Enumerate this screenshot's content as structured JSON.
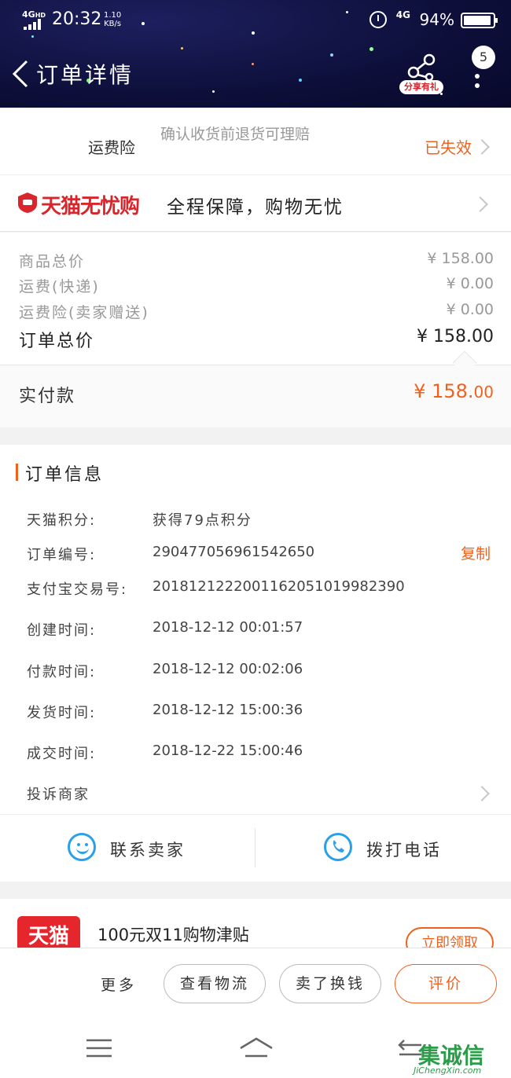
{
  "status_bar": {
    "network_left": "4G",
    "network_hd": "HD",
    "time": "20:32",
    "speed_value": "1.10",
    "speed_unit": "KB/s",
    "network_right": "4G",
    "battery": "94%"
  },
  "header": {
    "title": "订单详情",
    "share_label": "分享有礼",
    "message_count": "5"
  },
  "insurance": {
    "label": "运费险",
    "description": "确认收货前退货可理赔",
    "status": "已失效"
  },
  "guarantee": {
    "brand": "天猫无忧购",
    "slogan": "全程保障，购物无忧"
  },
  "price": {
    "items": [
      {
        "label": "商品总价",
        "value": "¥ 158.00"
      },
      {
        "label": "运费(快递)",
        "value": "¥ 0.00"
      },
      {
        "label": "运费险(卖家赠送)",
        "value": "¥ 0.00"
      }
    ],
    "total_label": "订单总价",
    "total_value": "¥ 158.00",
    "paid_label": "实付款",
    "paid_currency_int": "¥ 158.",
    "paid_decimal": "00"
  },
  "order_info": {
    "title": "订单信息",
    "rows": [
      {
        "label": "天猫积分:",
        "value": "获得79点积分"
      },
      {
        "label": "订单编号:",
        "value": "290477056961542650"
      },
      {
        "label": "支付宝交易号:",
        "value": "2018121222001162051019982390"
      },
      {
        "label": "创建时间:",
        "value": "2018-12-12 00:01:57"
      },
      {
        "label": "付款时间:",
        "value": "2018-12-12 00:02:06"
      },
      {
        "label": "发货时间:",
        "value": "2018-12-12 15:00:36"
      },
      {
        "label": "成交时间:",
        "value": "2018-12-22 15:00:46"
      }
    ],
    "copy_label": "复制",
    "complain_label": "投诉商家"
  },
  "contact": {
    "seller": "联系卖家",
    "phone": "拨打电话"
  },
  "promo": {
    "logo_text": "天猫",
    "title": "100元双11购物津贴",
    "button": "立即领取"
  },
  "actions": {
    "more": "更多",
    "logistics": "查看物流",
    "resell": "卖了换钱",
    "review": "评价"
  },
  "watermark": {
    "text": "集诚信",
    "sub": "JiChengXin.com"
  },
  "colors": {
    "accent": "#f0611d",
    "brand_red": "#d9262c",
    "header_bg": "#0d0f3a",
    "link_blue": "#2aa0e8"
  }
}
